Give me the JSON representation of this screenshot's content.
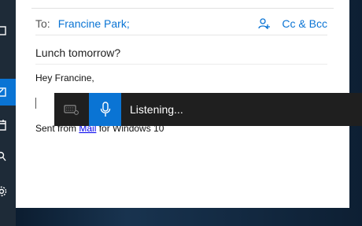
{
  "compose": {
    "to_label": "To:",
    "to_recipient": "Francine Park;",
    "cc_bcc_label": "Cc & Bcc",
    "subject": "Lunch tomorrow?",
    "greeting": "Hey Francine,",
    "signature_prefix": "Sent from ",
    "signature_link": "Mail",
    "signature_suffix": " for Windows 10"
  },
  "dictation": {
    "status": "Listening..."
  },
  "nav_rail": {
    "icons": [
      "window-icon",
      "mail-icon",
      "calendar-icon",
      "search-icon",
      "settings-icon"
    ]
  },
  "colors": {
    "accent": "#0a74d4",
    "toolbar_bg": "#1f1f1f",
    "rail_bg": "#1e2b38"
  }
}
